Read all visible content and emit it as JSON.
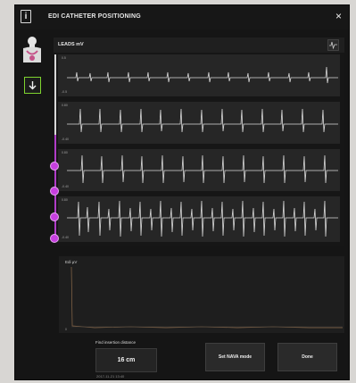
{
  "window": {
    "title": "EDI CATHETER POSITIONING",
    "info_icon_glyph": "i",
    "close_glyph": "×"
  },
  "ecg": {
    "leads_label": "LEADS mV",
    "strips": [
      {
        "top_tick": "0.5",
        "bottom_tick": "-0.5"
      },
      {
        "top_tick": "0.80",
        "bottom_tick": "-0.40"
      },
      {
        "top_tick": "0.80",
        "bottom_tick": "-0.40"
      },
      {
        "top_tick": "0.80",
        "bottom_tick": "-0.40"
      }
    ]
  },
  "edi": {
    "label": "Edi µV",
    "zero_tick": "0"
  },
  "footer": {
    "find_label": "Find insertion distance",
    "distance_value": "16 cm",
    "timestamp": "2017-11-21 13:40",
    "nava_button": "Set NAVA mode",
    "done_button": "Done"
  },
  "colors": {
    "window_bg": "#151515",
    "accent_green": "#7ed32f",
    "marker_purple": "#c73fe0",
    "trace": "#d9d9d9"
  },
  "icons": {
    "info": "info-icon",
    "close": "close-icon",
    "patient": "patient-torso-icon",
    "down_arrow": "arrow-down-icon",
    "settings": "waveform-settings-icon"
  }
}
